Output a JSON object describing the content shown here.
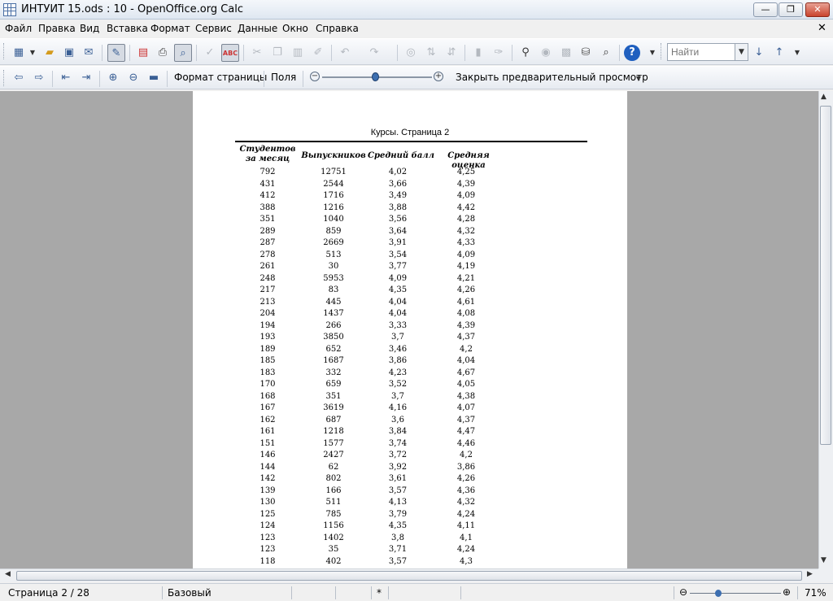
{
  "window": {
    "title": "ИНТУИТ 15.ods : 10 - OpenOffice.org Calc",
    "min_label": "—",
    "max_label": "❐",
    "close_label": "✕"
  },
  "menu": {
    "items": [
      "Файл",
      "Правка",
      "Вид",
      "Вставка",
      "Формат",
      "Сервис",
      "Данные",
      "Окно",
      "Справка"
    ],
    "close_doc": "✕"
  },
  "toolbar": {
    "icons": [
      "new-icon",
      "dropdown-icon",
      "open-icon",
      "save-icon",
      "email-icon",
      "edit-file-icon",
      "export-pdf-icon",
      "print-icon",
      "page-preview-icon",
      "spellcheck-icon",
      "autospell-icon",
      "cut-icon",
      "copy-icon",
      "paste-icon",
      "format-paintbrush-icon",
      "undo-icon",
      "redo-icon",
      "hyperlink-icon",
      "sort-ascending-icon",
      "sort-descending-icon",
      "chart-icon",
      "draw-icon",
      "find-replace-icon",
      "navigator-icon",
      "gallery-icon",
      "datasources-icon",
      "zoom-icon",
      "help-icon"
    ],
    "find_placeholder": "Найти",
    "find_next": "↓",
    "find_prev": "↑"
  },
  "preview_toolbar": {
    "format_page": "Формат страницы",
    "margins": "Поля",
    "zoom_minus": "−",
    "zoom_plus": "+",
    "close_preview": "Закрыть предварительный просмотр"
  },
  "page": {
    "title": "Курсы. Страница 2",
    "headers": [
      "Студентов за месяц",
      "Выпускников",
      "Средний балл",
      "Средняя оценка"
    ],
    "rows": [
      [
        "792",
        "12751",
        "4,02",
        "4,25"
      ],
      [
        "431",
        "2544",
        "3,66",
        "4,39"
      ],
      [
        "412",
        "1716",
        "3,49",
        "4,09"
      ],
      [
        "388",
        "1216",
        "3,88",
        "4,42"
      ],
      [
        "351",
        "1040",
        "3,56",
        "4,28"
      ],
      [
        "289",
        "859",
        "3,64",
        "4,32"
      ],
      [
        "287",
        "2669",
        "3,91",
        "4,33"
      ],
      [
        "278",
        "513",
        "3,54",
        "4,09"
      ],
      [
        "261",
        "30",
        "3,77",
        "4,19"
      ],
      [
        "248",
        "5953",
        "4,09",
        "4,21"
      ],
      [
        "217",
        "83",
        "4,35",
        "4,26"
      ],
      [
        "213",
        "445",
        "4,04",
        "4,61"
      ],
      [
        "204",
        "1437",
        "4,04",
        "4,08"
      ],
      [
        "194",
        "266",
        "3,33",
        "4,39"
      ],
      [
        "193",
        "3850",
        "3,7",
        "4,37"
      ],
      [
        "189",
        "652",
        "3,46",
        "4,2"
      ],
      [
        "185",
        "1687",
        "3,86",
        "4,04"
      ],
      [
        "183",
        "332",
        "4,23",
        "4,67"
      ],
      [
        "170",
        "659",
        "3,52",
        "4,05"
      ],
      [
        "168",
        "351",
        "3,7",
        "4,38"
      ],
      [
        "167",
        "3619",
        "4,16",
        "4,07"
      ],
      [
        "162",
        "687",
        "3,6",
        "4,37"
      ],
      [
        "161",
        "1218",
        "3,84",
        "4,47"
      ],
      [
        "151",
        "1577",
        "3,74",
        "4,46"
      ],
      [
        "146",
        "2427",
        "3,72",
        "4,2"
      ],
      [
        "144",
        "62",
        "3,92",
        "3,86"
      ],
      [
        "142",
        "802",
        "3,61",
        "4,26"
      ],
      [
        "139",
        "166",
        "3,57",
        "4,36"
      ],
      [
        "130",
        "511",
        "4,13",
        "4,32"
      ],
      [
        "125",
        "785",
        "3,79",
        "4,24"
      ],
      [
        "124",
        "1156",
        "4,35",
        "4,11"
      ],
      [
        "123",
        "1402",
        "3,8",
        "4,1"
      ],
      [
        "123",
        "35",
        "3,71",
        "4,24"
      ],
      [
        "118",
        "402",
        "3,57",
        "4,3"
      ]
    ]
  },
  "status": {
    "page": "Страница 2 / 28",
    "style": "Базовый",
    "modified": "*",
    "zoom": "71%"
  }
}
